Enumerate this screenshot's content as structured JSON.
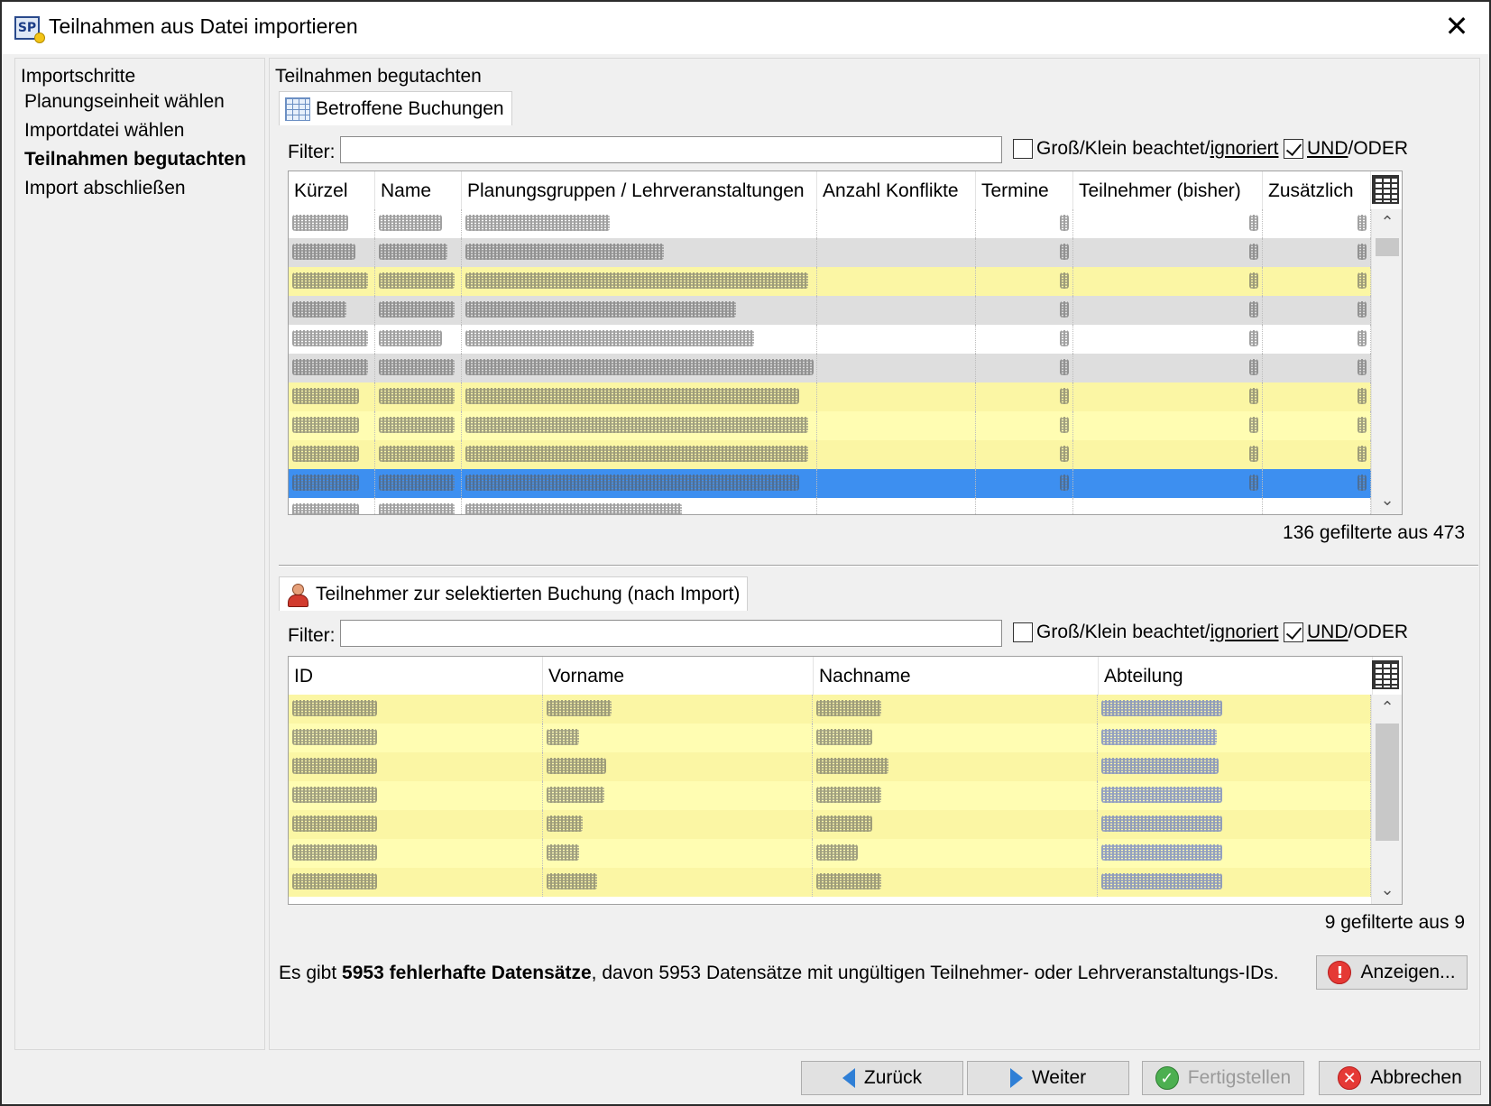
{
  "window": {
    "title": "Teilnahmen aus Datei importieren",
    "app_icon_text": "SP",
    "close_glyph": "✕"
  },
  "steps": {
    "heading": "Importschritte",
    "items": [
      {
        "label": "Planungseinheit wählen",
        "active": false
      },
      {
        "label": "Importdatei wählen",
        "active": false
      },
      {
        "label": "Teilnahmen begutachten",
        "active": true
      },
      {
        "label": "Import abschließen",
        "active": false
      }
    ]
  },
  "main": {
    "heading": "Teilnahmen begutachten",
    "bookings": {
      "tab_label": "Betroffene Buchungen",
      "tab_icon": "grid-table-icon",
      "filter_label": "Filter:",
      "filter_value": "",
      "case_check_label_pre": "Groß/Klein beachtet/",
      "case_check_label_link": "ignoriert",
      "case_checked": false,
      "andor_label_link": "UND",
      "andor_label_post": "/ODER",
      "andor_checked": true,
      "columns": [
        "Kürzel",
        "Name",
        "Planungsgruppen / Lehrveranstaltungen",
        "Anzahl Konflikte",
        "Termine",
        "Teilnehmer (bisher)",
        "Zusätzlich"
      ],
      "count_text": "136 gefilterte aus 473"
    },
    "participants": {
      "tab_label": "Teilnehmer zur selektierten Buchung (nach Import)",
      "tab_icon": "person-icon",
      "filter_label": "Filter:",
      "filter_value": "",
      "case_check_label_pre": "Groß/Klein beachtet/",
      "case_check_label_link": "ignoriert",
      "case_checked": false,
      "andor_label_link": "UND",
      "andor_label_post": "/ODER",
      "andor_checked": true,
      "columns": [
        "ID",
        "Vorname",
        "Nachname",
        "Abteilung"
      ],
      "count_text": "9 gefilterte aus 9"
    },
    "error": {
      "pre": "Es gibt ",
      "bold": "5953 fehlerhafte Datensätze",
      "post": ", davon 5953 Datensätze mit ungültigen Teilnehmer- oder Lehrveranstaltungs-IDs.",
      "button_label": "Anzeigen..."
    }
  },
  "footer": {
    "back_label": "Zurück",
    "next_label": "Weiter",
    "finish_label": "Fertigstellen",
    "cancel_label": "Abbrechen"
  },
  "colors": {
    "row_yellow": "#fbf6a4",
    "row_grey": "#dedede",
    "row_selected": "#3d8ff0",
    "accent_blue": "#2f7fd6"
  }
}
